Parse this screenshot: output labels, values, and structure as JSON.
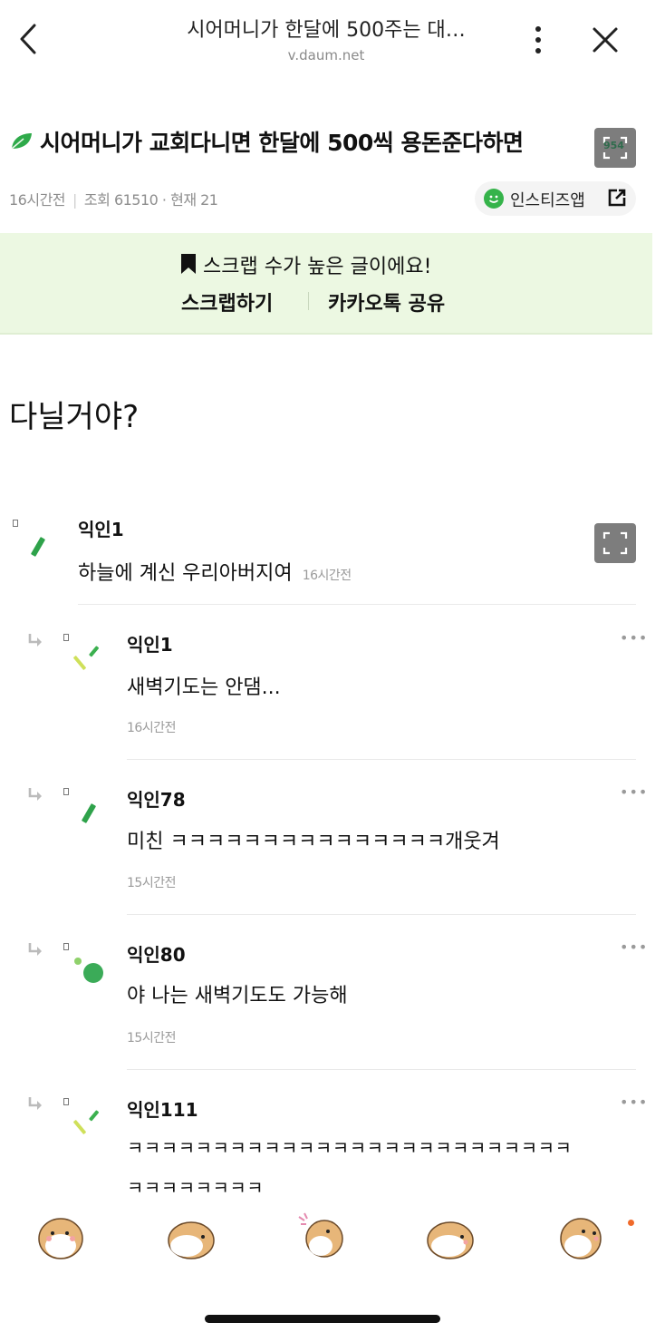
{
  "browser": {
    "title": "시어머니가 한달에 500주는 대…",
    "url": "v.daum.net"
  },
  "article": {
    "title": "시어머니가 교회다니면 한달에 500씩 용돈준다하면",
    "expand_badge": "954",
    "time": "16시간전",
    "views": "조회 61510 · 현재 21",
    "insti_app_label": "인스티즈앱",
    "body": "다닐거야?"
  },
  "banner": {
    "message": "스크랩 수가 높은 글이에요!",
    "scrap_label": "스크랩하기",
    "share_label": "카카오톡 공유"
  },
  "comments": [
    {
      "nick": "익인1",
      "text": "하늘에 계신 우리아버지여",
      "time": "16시간전",
      "reply": false
    },
    {
      "nick": "익인1",
      "text": "새벽기도는 안댐...",
      "time": "16시간전",
      "reply": true
    },
    {
      "nick": "익인78",
      "text": "미친 ㅋㅋㅋㅋㅋㅋㅋㅋㅋㅋㅋㅋㅋㅋㅋ개웃겨",
      "time": "15시간전",
      "reply": true
    },
    {
      "nick": "익인80",
      "text": "야 나는 새벽기도도 가능해",
      "time": "15시간전",
      "reply": true
    },
    {
      "nick": "익인111",
      "text": "ㅋㅋㅋㅋㅋㅋㅋㅋㅋㅋㅋㅋㅋㅋㅋㅋㅋㅋㅋㅋㅋㅋㅋㅋㅋㅋ",
      "text2": "ㅋㅋㅋㅋㅋㅋㅋㅋ",
      "reply": true
    }
  ],
  "colors": {
    "banner_bg": "#ecf8e2",
    "accent_green": "#35b34a",
    "notify_dot": "#f06a2a"
  }
}
